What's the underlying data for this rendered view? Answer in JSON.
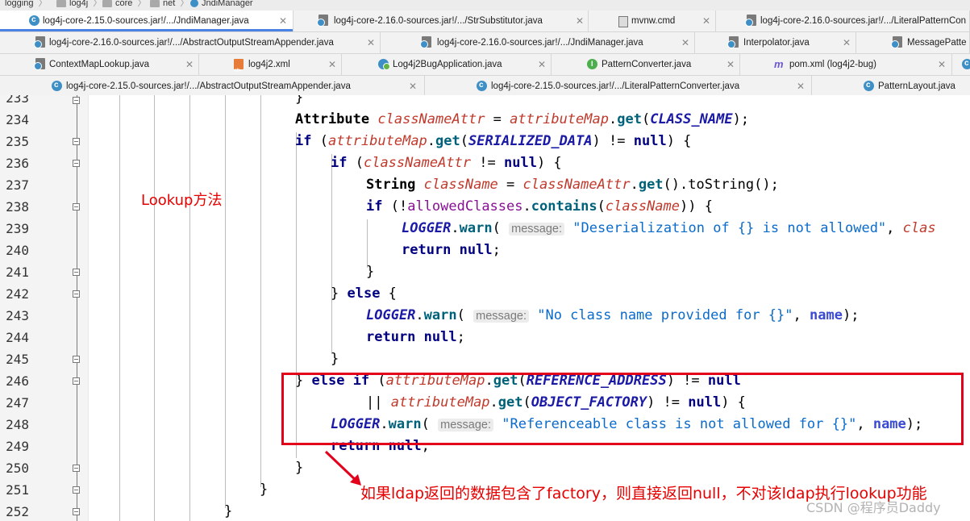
{
  "breadcrumb": [
    {
      "label": "logging"
    },
    {
      "label": "log4j"
    },
    {
      "label": "core"
    },
    {
      "label": "net"
    },
    {
      "label": "JndiManager"
    }
  ],
  "tab_rows": [
    [
      {
        "label": "log4j-core-2.15.0-sources.jar!/.../JndiManager.java",
        "icon": "class-c-icon",
        "active": true
      },
      {
        "label": "log4j-core-2.16.0-sources.jar!/.../StrSubstitutor.java",
        "icon": "library-class-icon"
      },
      {
        "label": "mvnw.cmd",
        "icon": "cmd-file-icon"
      },
      {
        "label": "log4j-core-2.16.0-sources.jar!/.../LiteralPatternCon",
        "icon": "library-class-icon"
      }
    ],
    [
      {
        "label": "log4j-core-2.16.0-sources.jar!/.../AbstractOutputStreamAppender.java",
        "icon": "library-class-icon"
      },
      {
        "label": "log4j-core-2.16.0-sources.jar!/.../JndiManager.java",
        "icon": "library-class-icon"
      },
      {
        "label": "Interpolator.java",
        "icon": "library-class-icon"
      },
      {
        "label": "MessagePatte",
        "icon": "library-class-icon"
      }
    ],
    [
      {
        "label": "ContextMapLookup.java",
        "icon": "library-class-icon"
      },
      {
        "label": "log4j2.xml",
        "icon": "xml-file-icon"
      },
      {
        "label": "Log4j2BugApplication.java",
        "icon": "spring-class-icon"
      },
      {
        "label": "PatternConverter.java",
        "icon": "interface-icon"
      },
      {
        "label": "pom.xml (log4j2-bug)",
        "icon": "maven-icon"
      }
    ],
    [
      {
        "label": "log4j-core-2.15.0-sources.jar!/.../AbstractOutputStreamAppender.java",
        "icon": "class-c-icon"
      },
      {
        "label": "log4j-core-2.15.0-sources.jar!/.../LiteralPatternConverter.java",
        "icon": "class-c-icon"
      },
      {
        "label": "PatternLayout.java",
        "icon": "class-c-icon"
      }
    ]
  ],
  "line_numbers": [
    "233",
    "234",
    "235",
    "236",
    "237",
    "238",
    "239",
    "240",
    "241",
    "242",
    "243",
    "244",
    "245",
    "246",
    "247",
    "248",
    "249",
    "250",
    "251",
    "252"
  ],
  "code": {
    "l233": "}",
    "l234": {
      "type": "Attribute",
      "var": "classNameAttr",
      "eq": " = ",
      "obj": "attributeMap",
      "dot": ".",
      "method": "get",
      "open": "(",
      "const": "CLASS_NAME",
      "close": ");"
    },
    "l235": {
      "kw": "if",
      "open": " (",
      "obj": "attributeMap",
      "dot": ".",
      "method": "get",
      "p": "(",
      "const": "SERIALIZED_DATA",
      "rest": ") != ",
      "null": "null",
      "end": ") {"
    },
    "l236": {
      "kw": "if",
      "open": " (",
      "var": "classNameAttr",
      "rest": " != ",
      "null": "null",
      "end": ") {"
    },
    "l237": {
      "type": "String",
      "var": "className",
      "eq": " = ",
      "obj": "classNameAttr",
      "dot": ".",
      "method": "get",
      "rest": "().toString();"
    },
    "l238": {
      "kw": "if",
      "open": " (!",
      "fld": "allowedClasses",
      "dot": ".",
      "method": "contains",
      "p": "(",
      "var": "className",
      "end": ")) {"
    },
    "l239": {
      "logger": "LOGGER",
      "dot": ".",
      "method": "warn",
      "p": "( ",
      "hint": "message:",
      "str": "\"Deserialization of {} is not allowed\"",
      "comma": ", ",
      "var": "clas"
    },
    "l240": {
      "kw": "return",
      "null": "null",
      "end": ";"
    },
    "l241": "}",
    "l242": {
      "brace": "} ",
      "kw": "else",
      "end": " {"
    },
    "l243": {
      "logger": "LOGGER",
      "dot": ".",
      "method": "warn",
      "p": "( ",
      "hint": "message:",
      "str": "\"No class name provided for {}\"",
      "comma": ", ",
      "name": "name",
      "end": ");"
    },
    "l244": {
      "kw": "return",
      "null": "null",
      "end": ";"
    },
    "l245": "}",
    "l246": {
      "brace": "} ",
      "kw1": "else",
      "kw2": "if",
      "open": " (",
      "obj": "attributeMap",
      "dot": ".",
      "method": "get",
      "p": "(",
      "const": "REFERENCE_ADDRESS",
      "rest": ") != ",
      "null": "null"
    },
    "l247": {
      "or": "|| ",
      "obj": "attributeMap",
      "dot": ".",
      "method": "get",
      "p": "(",
      "const": "OBJECT_FACTORY",
      "rest": ") != ",
      "null": "null",
      "end": ") {"
    },
    "l248": {
      "logger": "LOGGER",
      "dot": ".",
      "method": "warn",
      "p": "( ",
      "hint": "message:",
      "str": "\"Referenceable class is not allowed for {}\"",
      "comma": ", ",
      "name": "name",
      "end": ");"
    },
    "l249": {
      "kw": "return",
      "null": "null",
      "end": ";"
    },
    "l250": "}",
    "l251": "}",
    "l252": "}"
  },
  "annotations": {
    "lookup": "Lookup方法",
    "note": "如果ldap返回的数据包含了factory，则直接返回null，不对该ldap执行lookup功能"
  },
  "watermark": "CSDN @程序员Daddy",
  "colors": {
    "annotation": "#e60000",
    "highlight_box": "#e3001b",
    "active_tab_underline": "#4b82e6"
  }
}
